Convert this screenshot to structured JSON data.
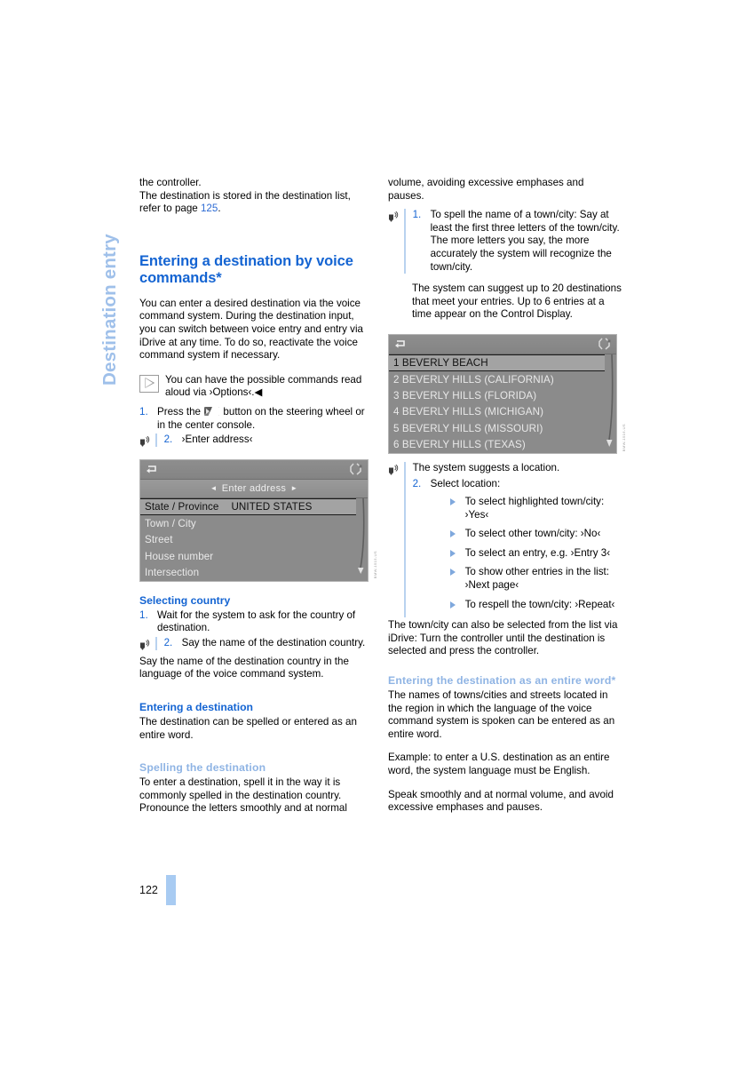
{
  "chapter": {
    "tab_label": "Destination entry"
  },
  "footer": {
    "page_number": "122"
  },
  "left_column": {
    "intro": {
      "line1": "the controller.",
      "line2": "The destination is stored in the destination list, refer to page ",
      "xref": "125",
      "line2_end": "."
    },
    "heading": "Entering a destination by voice commands*",
    "body1": "You can enter a desired destination via the voice command system. During the destination input, you can switch between voice entry and entry via iDrive at any time. To do so, reactivate the voice command system if necessary.",
    "note": "You can have the possible commands read aloud via ›Options‹.◀",
    "step1": {
      "num": "1.",
      "text_before": "Press the ",
      "text_after": " button on the steering wheel or in the center console."
    },
    "step2": {
      "num": "2.",
      "text": "›Enter address‹"
    },
    "display1": {
      "title": "Enter address",
      "rows": [
        {
          "label": "State / Province",
          "value": "UNITED STATES",
          "selected": true
        },
        {
          "label": "Town / City",
          "value": "",
          "selected": false
        },
        {
          "label": "Street",
          "value": "",
          "selected": false
        },
        {
          "label": "House number",
          "value": "",
          "selected": false
        },
        {
          "label": "Intersection",
          "value": "",
          "selected": false
        }
      ],
      "fig_code": "BMW-1515-US"
    },
    "selecting_country": {
      "heading": "Selecting country",
      "step1": {
        "num": "1.",
        "text": "Wait for the system to ask for the country of destination."
      },
      "step2": {
        "num": "2.",
        "text": "Say the name of the destination country."
      },
      "after": "Say the name of the destination country in the language of the voice command system."
    },
    "entering_destination": {
      "heading": "Entering a destination",
      "body": "The destination can be spelled or entered as an entire word."
    },
    "spelling": {
      "heading": "Spelling the destination",
      "body": "To enter a destination, spell it in the way it is commonly spelled in the destination country. Pronounce the letters smoothly and at normal"
    }
  },
  "right_column": {
    "cont": "volume, avoiding excessive emphases and pauses.",
    "step1": {
      "num": "1.",
      "text": "To spell the name of a town/city: Say at least the first three letters of the town/city. The more letters you say, the more accurately the system will recognize the town/city."
    },
    "after_step1": "The system can suggest up to 20 destinations that meet your entries. Up to 6 entries at a time appear on the Control Display.",
    "display2": {
      "rows": [
        {
          "label": "1 BEVERLY BEACH",
          "selected": true
        },
        {
          "label": "2 BEVERLY HILLS (CALIFORNIA)",
          "selected": false
        },
        {
          "label": "3 BEVERLY HILLS (FLORIDA)",
          "selected": false
        },
        {
          "label": "4 BEVERLY HILLS (MICHIGAN)",
          "selected": false
        },
        {
          "label": "5 BEVERLY HILLS (MISSOURI)",
          "selected": false
        },
        {
          "label": "6 BEVERLY HILLS (TEXAS)",
          "selected": false
        }
      ],
      "fig_code": "BMW-1516-US"
    },
    "suggests": "The system suggests a location.",
    "step2": {
      "num": "2.",
      "text": "Select location:"
    },
    "bullets": [
      "To select highlighted town/city: ›Yes‹",
      "To select other town/city: ›No‹",
      "To select an entry, e.g. ›Entry 3‹",
      "To show other entries in the list: ›Next page‹",
      "To respell the town/city: ›Repeat‹"
    ],
    "idrive": "The town/city can also be selected from the list via iDrive: Turn the controller until the destination is selected and press the controller.",
    "entire_word": {
      "heading": "Entering the destination as an entire word*",
      "body1": "The names of towns/cities and streets located in the region in which the language of the voice command system is spoken can be entered as an entire word.",
      "body2": "Example: to enter a U.S. destination as an entire word, the system language must be English.",
      "body3": "Speak smoothly and at normal volume, and avoid excessive emphases and pauses."
    }
  },
  "colors": {
    "heading_blue": "#1464d2",
    "light_blue": "#8fb4e4",
    "tab_blue": "#9fc0ea",
    "footer_bar": "#a8cbf2"
  }
}
